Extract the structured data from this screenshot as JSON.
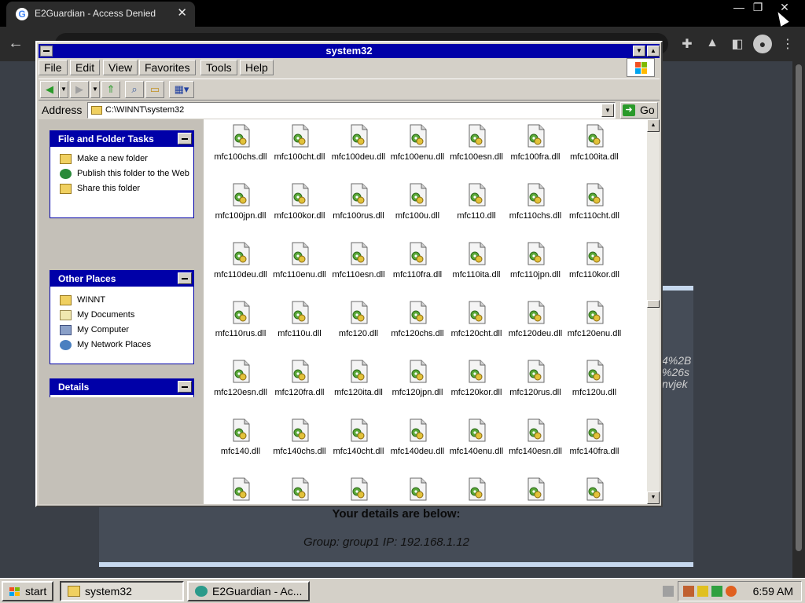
{
  "browser": {
    "tab_title": "E2Guardian - Access Denied",
    "tab_close": "✕",
    "favicon": "G",
    "window_controls": [
      "—",
      "❐",
      "✕"
    ],
    "url_text": "",
    "back_icon": "←"
  },
  "page": {
    "url_fragment_lines": [
      "4%2B",
      "%26s",
      "nvjek"
    ],
    "details_heading": "Your details are below:",
    "group_line": "Group: group1   IP: 192.168.1.12"
  },
  "explorer": {
    "title": "system32",
    "menu": [
      "File",
      "Edit",
      "View",
      "Favorites",
      "Tools",
      "Help"
    ],
    "address_label": "Address",
    "address_value": "C:\\WINNT\\system32",
    "go_label": "Go",
    "panels": {
      "tasks": {
        "title": "File and Folder Tasks",
        "items": [
          "Make a new folder",
          "Publish this folder to the Web",
          "Share this folder"
        ]
      },
      "places": {
        "title": "Other Places",
        "items": [
          "WINNT",
          "My Documents",
          "My Computer",
          "My Network Places"
        ]
      },
      "details": {
        "title": "Details"
      }
    },
    "files": [
      "mfc100chs.dll",
      "mfc100cht.dll",
      "mfc100deu.dll",
      "mfc100enu.dll",
      "mfc100esn.dll",
      "mfc100fra.dll",
      "mfc100ita.dll",
      "mfc100jpn.dll",
      "mfc100kor.dll",
      "mfc100rus.dll",
      "mfc100u.dll",
      "mfc110.dll",
      "mfc110chs.dll",
      "mfc110cht.dll",
      "mfc110deu.dll",
      "mfc110enu.dll",
      "mfc110esn.dll",
      "mfc110fra.dll",
      "mfc110ita.dll",
      "mfc110jpn.dll",
      "mfc110kor.dll",
      "mfc110rus.dll",
      "mfc110u.dll",
      "mfc120.dll",
      "mfc120chs.dll",
      "mfc120cht.dll",
      "mfc120deu.dll",
      "mfc120enu.dll",
      "mfc120esn.dll",
      "mfc120fra.dll",
      "mfc120ita.dll",
      "mfc120jpn.dll",
      "mfc120kor.dll",
      "mfc120rus.dll",
      "mfc120u.dll",
      "mfc140.dll",
      "mfc140chs.dll",
      "mfc140cht.dll",
      "mfc140deu.dll",
      "mfc140enu.dll",
      "mfc140esn.dll",
      "mfc140fra.dll",
      "",
      "",
      "",
      "",
      "",
      "",
      ""
    ]
  },
  "taskbar": {
    "start_label": "start",
    "tasks": [
      "system32",
      "E2Guardian - Ac..."
    ],
    "clock": "6:59 AM"
  },
  "colors": {
    "titlebar": "#0000a8",
    "panel_header": "#0000a8",
    "face": "#d4d0c8"
  }
}
